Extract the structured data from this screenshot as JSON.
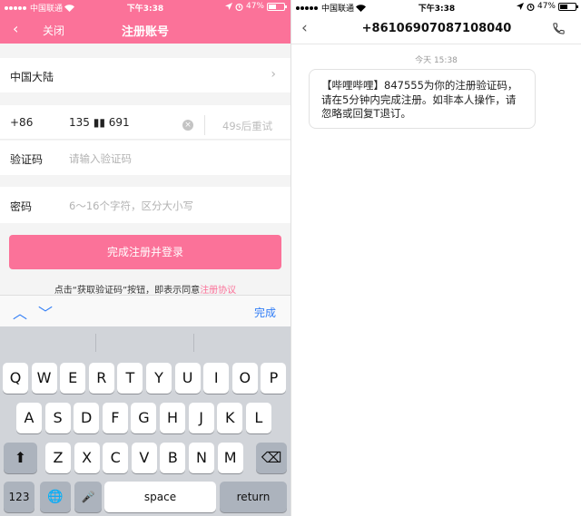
{
  "left": {
    "status": {
      "carrier": "中国联通",
      "time": "下午3:38",
      "battery": "47%",
      "battery_level": 0.47
    },
    "nav": {
      "back_glyph": "‹",
      "close_label": "关闭",
      "title": "注册账号"
    },
    "region": {
      "value": "中国大陆"
    },
    "phone": {
      "country_code": "+86",
      "number": "135 ▮▮ 691",
      "resend_label": "49s后重试"
    },
    "verification": {
      "label": "验证码",
      "placeholder": "请输入验证码"
    },
    "password": {
      "label": "密码",
      "placeholder": "6～16个字符，区分大小写"
    },
    "submit_label": "完成注册并登录",
    "agreement": {
      "text": "点击“获取验证码”按钮，即表示同意",
      "link": "注册协议"
    },
    "keyboard_toolbar": {
      "up": "︿",
      "down": "﹀",
      "done": "完成"
    },
    "keyboard": {
      "row1": [
        "Q",
        "W",
        "E",
        "R",
        "T",
        "Y",
        "U",
        "I",
        "O",
        "P"
      ],
      "row2": [
        "A",
        "S",
        "D",
        "F",
        "G",
        "H",
        "J",
        "K",
        "L"
      ],
      "row3": [
        "Z",
        "X",
        "C",
        "V",
        "B",
        "N",
        "M"
      ],
      "shift": "⬆",
      "delete": "⌫",
      "numbers": "123",
      "globe": "🌐",
      "mic": "🎤",
      "space": "space",
      "return": "return"
    }
  },
  "right": {
    "status": {
      "carrier": "中国联通",
      "time": "下午3:38",
      "battery": "47%",
      "battery_level": 0.47
    },
    "nav": {
      "back_glyph": "‹",
      "title": "+86106907087108040"
    },
    "timestamp": "今天 15:38",
    "message": "【哔哩哔哩】847555为你的注册验证码，请在5分钟内完成注册。如非本人操作，请忽略或回复T退订。"
  },
  "colors": {
    "brand_pink": "#fb7299",
    "link_blue": "#2f7cf6"
  }
}
